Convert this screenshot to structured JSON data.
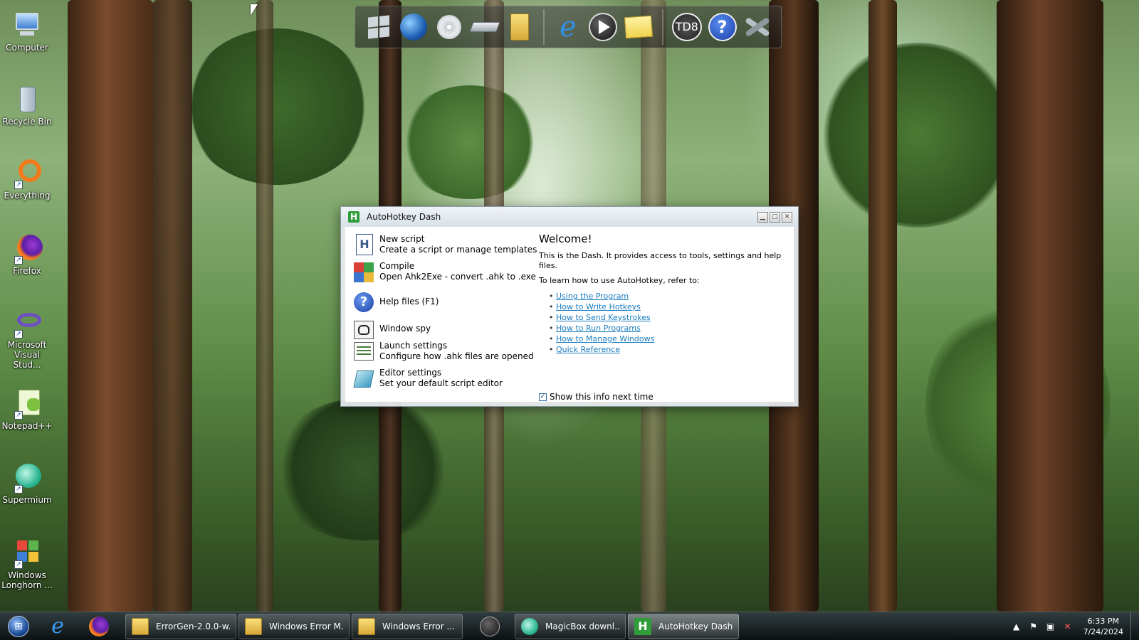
{
  "desktop": {
    "icons": [
      {
        "label": "Computer",
        "icon": "computer-icon"
      },
      {
        "label": "Recycle Bin",
        "icon": "recycle-bin-icon"
      },
      {
        "label": "Everything",
        "icon": "everything-icon"
      },
      {
        "label": "Firefox",
        "icon": "firefox-icon"
      },
      {
        "label": "Microsoft Visual Stud...",
        "icon": "visual-studio-icon"
      },
      {
        "label": "Notepad++",
        "icon": "notepadpp-icon"
      },
      {
        "label": "Supermium",
        "icon": "supermium-icon"
      },
      {
        "label": "Windows Longhorn ...",
        "icon": "windows-longhorn-icon"
      }
    ]
  },
  "dock": {
    "items": [
      {
        "icon": "windows-flag-icon"
      },
      {
        "icon": "globe-icon"
      },
      {
        "icon": "cd-drive-icon"
      },
      {
        "icon": "hard-drive-icon"
      },
      {
        "icon": "folder-icon"
      },
      {
        "icon": "internet-explorer-icon"
      },
      {
        "icon": "media-player-icon"
      },
      {
        "icon": "sticky-note-icon"
      },
      {
        "icon": "td8-icon",
        "text": "TD8"
      },
      {
        "icon": "help-icon",
        "text": "?"
      },
      {
        "icon": "tools-icon"
      }
    ]
  },
  "window": {
    "title": "AutoHotkey Dash",
    "tools": [
      {
        "name": "New script",
        "desc": "Create a script or manage templates",
        "icon": "new-script-icon"
      },
      {
        "name": "Compile",
        "desc": "Open Ahk2Exe - convert .ahk to .exe",
        "icon": "compile-icon"
      },
      {
        "name": "Help files (F1)",
        "desc": "",
        "icon": "help-icon"
      },
      {
        "name": "Window spy",
        "desc": "",
        "icon": "window-spy-icon"
      },
      {
        "name": "Launch settings",
        "desc": "Configure how .ahk files are opened",
        "icon": "launch-settings-icon"
      },
      {
        "name": "Editor settings",
        "desc": "Set your default script editor",
        "icon": "editor-settings-icon"
      }
    ],
    "welcome": {
      "heading": "Welcome!",
      "intro": "This is the Dash. It provides access to tools, settings and help files.",
      "learn": "To learn how to use AutoHotkey, refer to:",
      "links": [
        "Using the Program",
        "How to Write Hotkeys",
        "How to Send Keystrokes",
        "How to Run Programs",
        "How to Manage Windows",
        "Quick Reference"
      ]
    },
    "show_info_label": "Show this info next time",
    "show_info_checked": true
  },
  "taskbar": {
    "buttons": [
      {
        "label": "ErrorGen-2.0.0-w...",
        "icon": "folder-icon",
        "active": false
      },
      {
        "label": "Windows Error M...",
        "icon": "folder-icon",
        "active": false
      },
      {
        "label": "Windows Error ...",
        "icon": "folder-icon",
        "active": false
      },
      {
        "label": "MagicBox downl...",
        "icon": "supermium-icon",
        "active": false
      },
      {
        "label": "AutoHotkey Dash",
        "icon": "autohotkey-icon",
        "active": true
      }
    ],
    "clock_time": "6:33 PM",
    "clock_date": "7/24/2024"
  },
  "colors": {
    "link": "#1a7cc1",
    "ahk_green": "#2f9d3a"
  }
}
